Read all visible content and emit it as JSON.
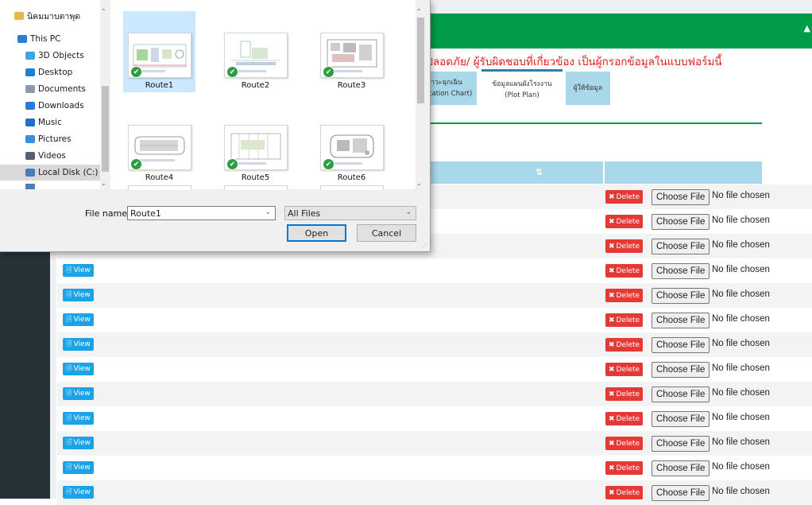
{
  "page": {
    "notice": "สวกรความปลอดภัย/ ผู้รับผิดชอบที่เกี่ยวข้อง เป็นผู้กรอกข้อมูลในแบบฟอร์มนี้",
    "tabs": [
      {
        "line1": "ผังทีมตอบโต้ภาวะฉุกเฉิน",
        "line2": "hart/Communication Chart)"
      },
      {
        "line1": "ข้อมูลแผนผังโรงงาน",
        "line2": "(Plot Plan)"
      },
      {
        "line1": "ผู้ให้ข้อมูล",
        "line2": ""
      }
    ],
    "sort_glyph": "⇅",
    "view_label": "View",
    "delete_label": "Delete",
    "choose_file_label": "Choose File",
    "no_file_label": "No file chosen"
  },
  "dialog": {
    "nav": [
      {
        "label": "นิคมมาบตาพุด",
        "icon": "pin-icon",
        "color": "#e8b74a"
      },
      {
        "label": "This PC",
        "icon": "computer-icon",
        "color": "#2a7fd4"
      },
      {
        "label": "3D Objects",
        "icon": "cube-icon",
        "color": "#3da5e0"
      },
      {
        "label": "Desktop",
        "icon": "desktop-icon",
        "color": "#1c7fd6"
      },
      {
        "label": "Documents",
        "icon": "document-icon",
        "color": "#8a9bb0"
      },
      {
        "label": "Downloads",
        "icon": "download-icon",
        "color": "#2b7bd6"
      },
      {
        "label": "Music",
        "icon": "music-icon",
        "color": "#1f6fc8"
      },
      {
        "label": "Pictures",
        "icon": "picture-icon",
        "color": "#3a8fd8"
      },
      {
        "label": "Videos",
        "icon": "video-icon",
        "color": "#555f6e"
      },
      {
        "label": "Local Disk (C:)",
        "icon": "disk-icon",
        "color": "#4a7fb5"
      }
    ],
    "files": [
      {
        "name": "Route1"
      },
      {
        "name": "Route2"
      },
      {
        "name": "Route3"
      },
      {
        "name": "Route4"
      },
      {
        "name": "Route5"
      },
      {
        "name": "Route6"
      }
    ],
    "filename_label": "File name:",
    "filename_value": "Route1",
    "filter_value": "All Files",
    "open_label": "Open",
    "cancel_label": "Cancel"
  }
}
